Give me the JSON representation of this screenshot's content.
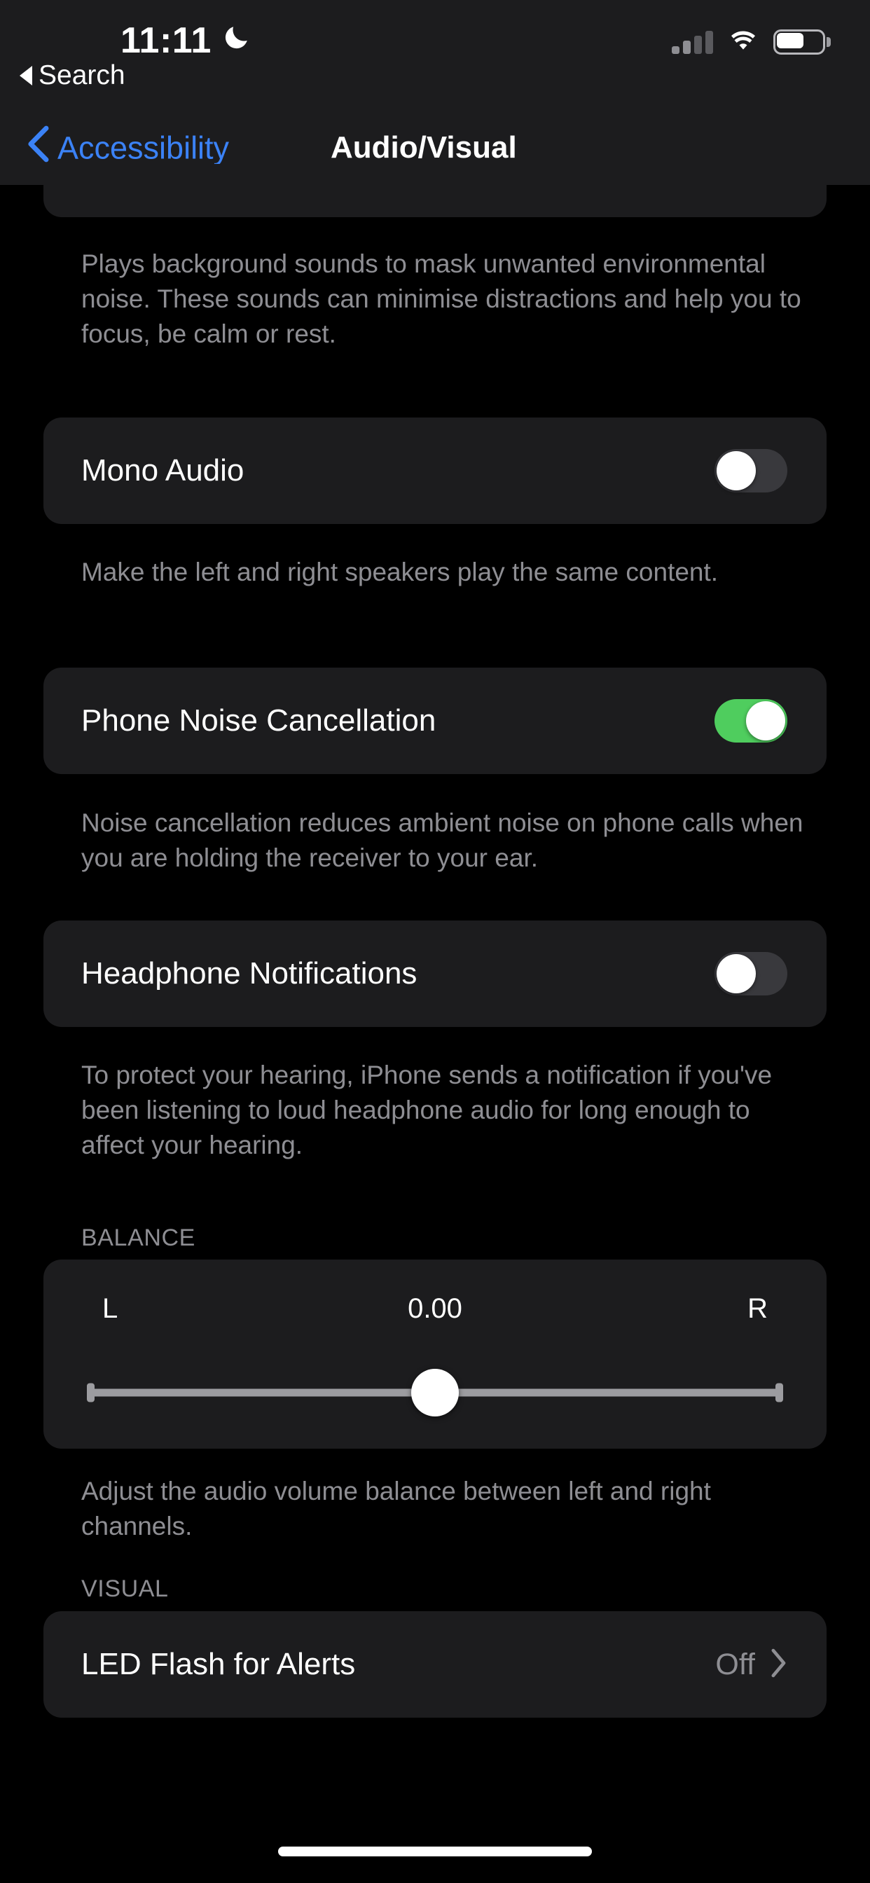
{
  "status_bar": {
    "time": "11:11",
    "dnd_icon": "crescent-moon-icon",
    "cellular_icon": "cellular-signal-icon",
    "cellular_bars_active": 2,
    "cellular_bars_total": 4,
    "wifi_icon": "wifi-icon",
    "battery_icon": "battery-icon",
    "battery_level_percent": 60
  },
  "search_back": {
    "label": "Search",
    "icon": "triangle-left-icon"
  },
  "nav": {
    "back_label": "Accessibility",
    "back_icon": "chevron-left-icon",
    "title": "Audio/Visual",
    "accent_color": "#3b82f6"
  },
  "sections": {
    "background_sounds_footnote": "Plays background sounds to mask unwanted environmental noise. These sounds can minimise distractions and help you to focus, be calm or rest.",
    "mono_audio": {
      "label": "Mono Audio",
      "toggle_state": "off",
      "footnote": "Make the left and right speakers play the same content."
    },
    "phone_noise_cancellation": {
      "label": "Phone Noise Cancellation",
      "toggle_state": "on",
      "toggle_on_color": "#4fcd5e",
      "footnote": "Noise cancellation reduces ambient noise on phone calls when you are holding the receiver to your ear."
    },
    "headphone_notifications": {
      "label": "Headphone Notifications",
      "toggle_state": "off",
      "footnote": "To protect your hearing, iPhone sends a notification if you've been listening to loud headphone audio for long enough to affect your hearing."
    },
    "balance": {
      "header": "BALANCE",
      "left_label": "L",
      "value": "0.00",
      "right_label": "R",
      "slider_position_percent": 50,
      "footnote": "Adjust the audio volume balance between left and right channels."
    },
    "visual": {
      "header": "VISUAL",
      "led_flash": {
        "label": "LED Flash for Alerts",
        "value": "Off",
        "chevron_icon": "chevron-right-icon"
      }
    }
  },
  "home_indicator": "home-indicator"
}
